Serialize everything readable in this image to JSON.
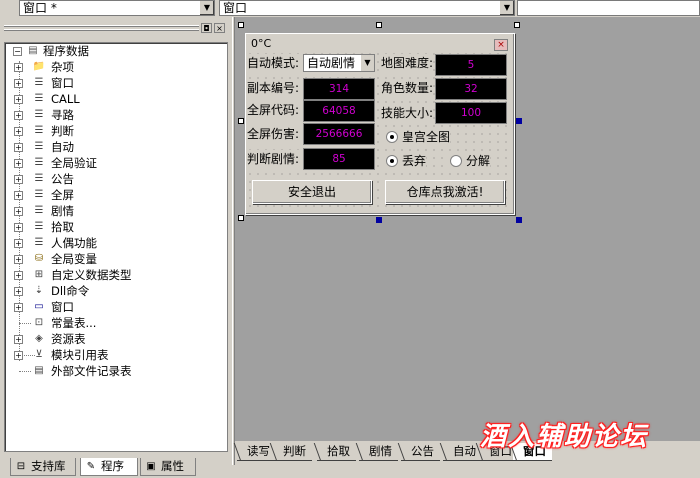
{
  "toolbar": {
    "left_combo": "窗口 *",
    "right_combo": "窗口"
  },
  "panel": {
    "restore_glyph": "◘",
    "close_glyph": "×"
  },
  "tree": {
    "root": "程序数据",
    "items": [
      {
        "label": "杂项",
        "icon": "folder-icon"
      },
      {
        "label": "窗口",
        "icon": "module-icon"
      },
      {
        "label": "CALL",
        "icon": "module-icon"
      },
      {
        "label": "寻路",
        "icon": "module-icon"
      },
      {
        "label": "判断",
        "icon": "module-icon"
      },
      {
        "label": "自动",
        "icon": "module-icon"
      },
      {
        "label": "全局验证",
        "icon": "module-icon"
      },
      {
        "label": "公告",
        "icon": "module-icon"
      },
      {
        "label": "全屏",
        "icon": "module-icon"
      },
      {
        "label": "剧情",
        "icon": "module-icon"
      },
      {
        "label": "拾取",
        "icon": "module-icon"
      },
      {
        "label": "人偶功能",
        "icon": "module-icon"
      },
      {
        "label": "全局变量",
        "icon": "database-icon"
      },
      {
        "label": "自定义数据类型",
        "icon": "datatype-icon"
      },
      {
        "label": "Dll命令",
        "icon": "dll-icon"
      },
      {
        "label": "窗口",
        "icon": "window-icon"
      },
      {
        "label": "常量表...",
        "icon": "constant-icon"
      },
      {
        "label": "资源表",
        "icon": "resource-icon"
      },
      {
        "label": "模块引用表",
        "icon": "module-ref-icon"
      },
      {
        "label": "外部文件记录表",
        "icon": "file-record-icon"
      }
    ]
  },
  "left_tabs": [
    "支持库",
    "程序",
    "属性"
  ],
  "form": {
    "title": "0°C",
    "close_glyph": "×",
    "mode_label": "自动模式:",
    "mode_value": "自动剧情",
    "map_label": "地图难度:",
    "map_value": "5",
    "dungeon_label": "副本编号:",
    "dungeon_value": "314",
    "role_label": "角色数量:",
    "role_value": "32",
    "fullcode_label": "全屏代码:",
    "fullcode_value": "64058",
    "skill_label": "技能大小:",
    "skill_value": "100",
    "damage_label": "全屏伤害:",
    "damage_value": "2566666",
    "judge_label": "判断剧情:",
    "judge_value": "85",
    "check_palace": "皇宫全图",
    "radio_discard": "丢弃",
    "radio_decompose": "分解",
    "btn_exit": "安全退出",
    "btn_activate": "仓库点我激活!"
  },
  "window_tabs": [
    "读写",
    "判断",
    "拾取",
    "剧情",
    "公告",
    "自动",
    "窗口",
    "窗口"
  ],
  "watermark": "酒入辅助论坛"
}
